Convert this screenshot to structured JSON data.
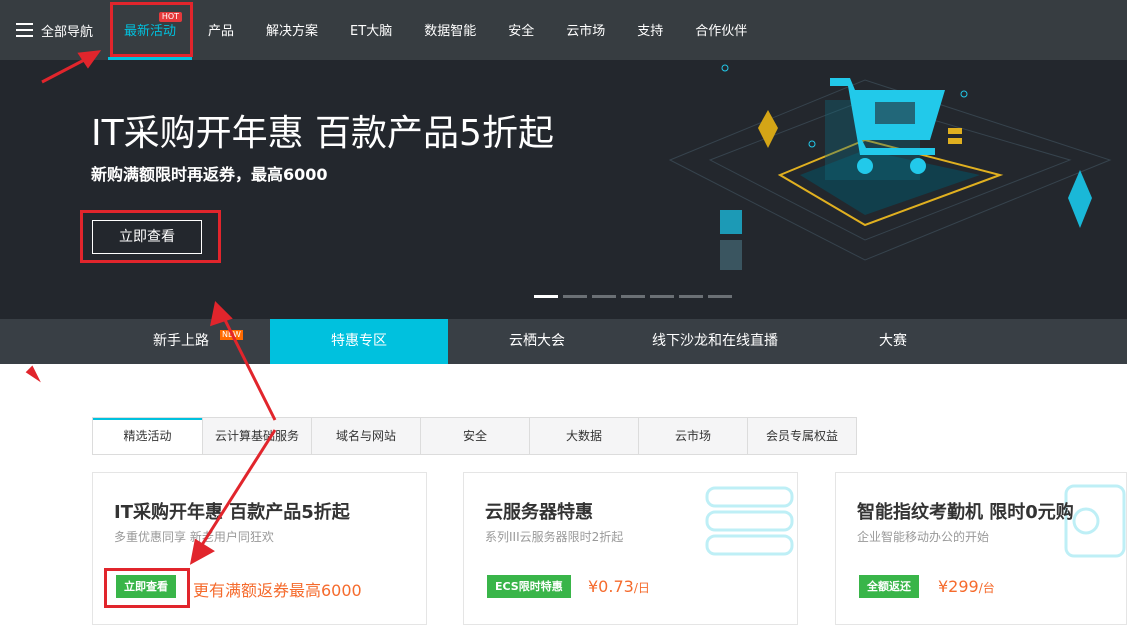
{
  "topnav": {
    "all_nav": "全部导航",
    "items": [
      {
        "label": "最新活动",
        "badge": "HOT"
      },
      {
        "label": "产品"
      },
      {
        "label": "解决方案"
      },
      {
        "label": "ET大脑"
      },
      {
        "label": "数据智能"
      },
      {
        "label": "安全"
      },
      {
        "label": "云市场"
      },
      {
        "label": "支持"
      },
      {
        "label": "合作伙伴"
      }
    ]
  },
  "hero": {
    "title": "IT采购开年惠 百款产品5折起",
    "subtitle": "新购满额限时再返券，最高6000",
    "button": "立即查看",
    "slides_total": 7,
    "active_slide": 1
  },
  "subnav": {
    "items": [
      {
        "label": "新手上路",
        "badge": "NEW"
      },
      {
        "label": "特惠专区"
      },
      {
        "label": "云栖大会"
      },
      {
        "label": "线下沙龙和在线直播"
      },
      {
        "label": "大赛"
      }
    ],
    "active": "特惠专区"
  },
  "tabs": [
    "精选活动",
    "云计算基础服务",
    "域名与网站",
    "安全",
    "大数据",
    "云市场",
    "会员专属权益"
  ],
  "cards": [
    {
      "title": "IT采购开年惠 百款产品5折起",
      "desc": "多重优惠同享 新老用户同狂欢",
      "tag": "立即查看",
      "price": "更有满额返券最高6000",
      "unit": ""
    },
    {
      "title": "云服务器特惠",
      "desc": "系列III云服务器限时2折起",
      "tag": "ECS限时特惠",
      "price": "¥0.73",
      "unit": "/日"
    },
    {
      "title": "智能指纹考勤机 限时0元购",
      "desc": "企业智能移动办公的开始",
      "tag": "全额返还",
      "price": "¥299",
      "unit": "/台"
    }
  ],
  "colors": {
    "accent": "#00c1de",
    "topnav_bg": "#373d41",
    "hero_bg": "#23272d",
    "tag_green": "#39b549",
    "price_orange": "#f56b2d",
    "annotation_red": "#e1252c"
  }
}
